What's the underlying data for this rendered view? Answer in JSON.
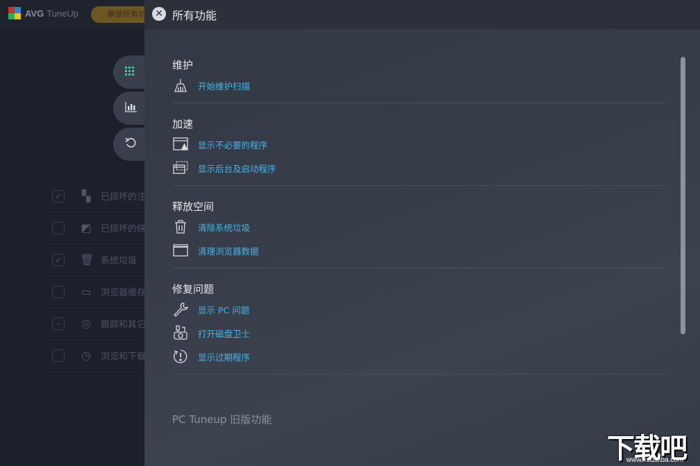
{
  "app": {
    "brand": "AVG",
    "name": "TuneUp",
    "unlock_label": "解锁所有功能"
  },
  "background_list": [
    {
      "label": "已损坏的注",
      "icon": "apps-icon",
      "checked": true
    },
    {
      "label": "已损坏的快",
      "icon": "shortcut-icon",
      "checked": false
    },
    {
      "label": "系统垃圾",
      "icon": "trash-icon",
      "checked": true
    },
    {
      "label": "浏览器缓存",
      "icon": "browser-icon",
      "checked": false
    },
    {
      "label": "跟踪和其它",
      "icon": "target-icon",
      "checked": false
    },
    {
      "label": "浏览和下载",
      "icon": "history-icon",
      "checked": false
    }
  ],
  "panel": {
    "title": "所有功能",
    "sections": [
      {
        "title": "维护",
        "items": [
          {
            "label": "开始维护扫描",
            "icon": "broom-icon"
          }
        ]
      },
      {
        "title": "加速",
        "items": [
          {
            "label": "显示不必要的程序",
            "icon": "window-warning-icon"
          },
          {
            "label": "显示后台及启动程序",
            "icon": "windows-stack-icon"
          }
        ]
      },
      {
        "title": "释放空间",
        "items": [
          {
            "label": "清除系统垃圾",
            "icon": "trash-icon"
          },
          {
            "label": "清理浏览器数据",
            "icon": "browser-window-icon"
          }
        ]
      },
      {
        "title": "修复问题",
        "items": [
          {
            "label": "显示 PC 问题",
            "icon": "wrench-icon"
          },
          {
            "label": "打开磁盘卫士",
            "icon": "disk-doctor-icon"
          },
          {
            "label": "显示过期程序",
            "icon": "outdated-clock-icon"
          }
        ]
      }
    ],
    "legacy_title": "PC Tuneup 旧版功能"
  },
  "watermark": {
    "text": "下载吧",
    "url": "www.xiazaiba.com"
  },
  "colors": {
    "accent": "#45b4ea",
    "panel_bg": "#363c47",
    "unlock": "#6e5623"
  }
}
